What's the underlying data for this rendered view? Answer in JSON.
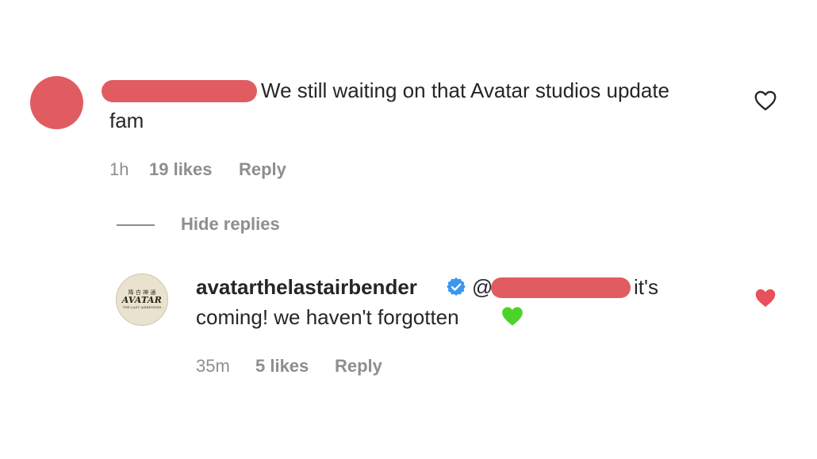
{
  "colors": {
    "redaction": "#e05c61",
    "muted_text": "#8e8e8e",
    "primary_text": "#262626",
    "verified_blue": "#3897f0",
    "liked_red": "#e8505b",
    "green_heart": "#4cd32a"
  },
  "comment": {
    "text_line1": "We still waiting on that Avatar studios update",
    "text_line2": "fam",
    "time": "1h",
    "likes": "19 likes",
    "reply_label": "Reply",
    "like_icon": "heart-outline-icon"
  },
  "hide_replies_label": "Hide replies",
  "reply": {
    "username": "avatarthelastairbender",
    "verified_icon": "verified-badge-icon",
    "mention_prefix": "@",
    "text_line1": "it's",
    "text_line2": "coming! we haven't forgotten",
    "emoji_icon": "green-heart-icon",
    "time": "35m",
    "likes": "5 likes",
    "reply_label": "Reply",
    "like_icon": "heart-filled-icon",
    "avatar_logo": {
      "glyphs": "降 卋 神 通",
      "wordmark": "AVATAR",
      "tagline": "THE LAST AIRBENDER"
    }
  }
}
